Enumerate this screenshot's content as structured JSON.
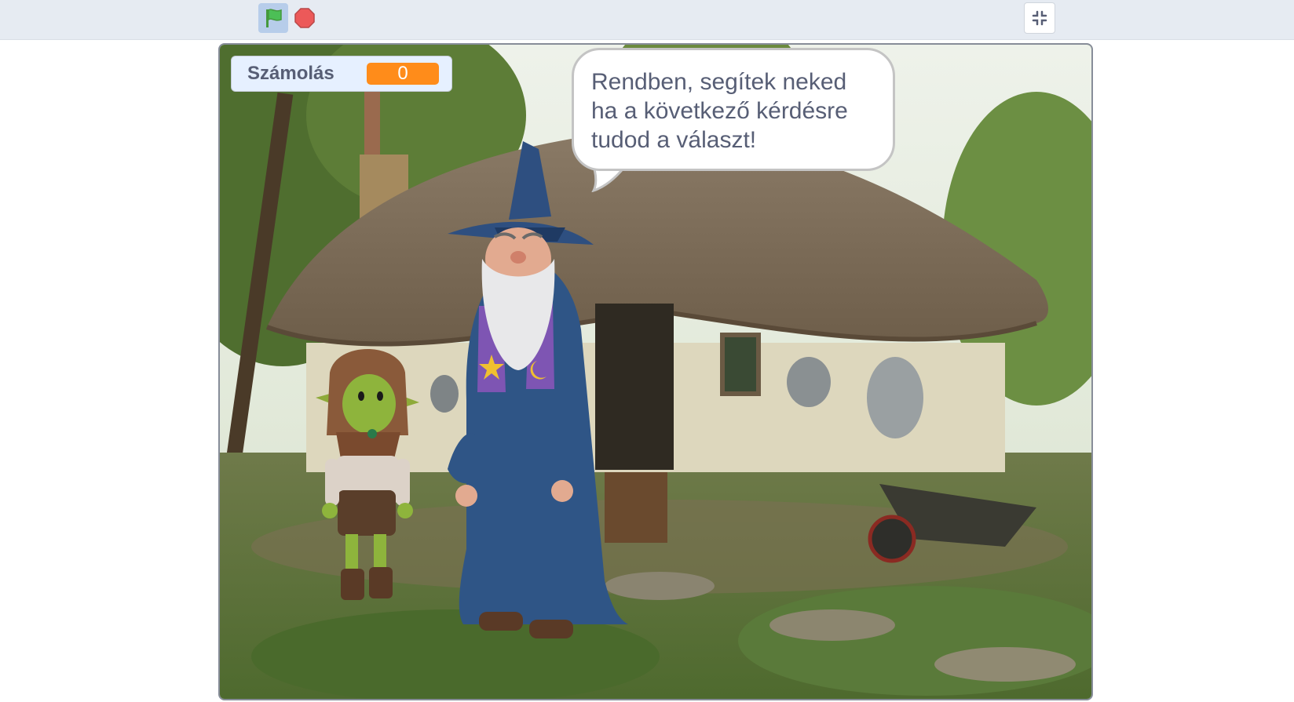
{
  "toolbar": {
    "green_flag_icon": "green-flag-icon",
    "stop_icon": "stop-sign-icon",
    "fullscreen_icon": "exit-fullscreen-icon",
    "flag_color": "#4cbf56",
    "stop_color": "#ec5959"
  },
  "monitor": {
    "label": "Számolás",
    "value": "0",
    "value_color": "#ff8c1a"
  },
  "speech_bubble": {
    "text": "Rendben, segítek neked\nha a következő kérdésre\ntudod a választ!"
  },
  "sprites": {
    "wizard": "wizard-sprite",
    "goblin": "goblin-sprite"
  },
  "backdrop": "thatched-cottage-backdrop"
}
